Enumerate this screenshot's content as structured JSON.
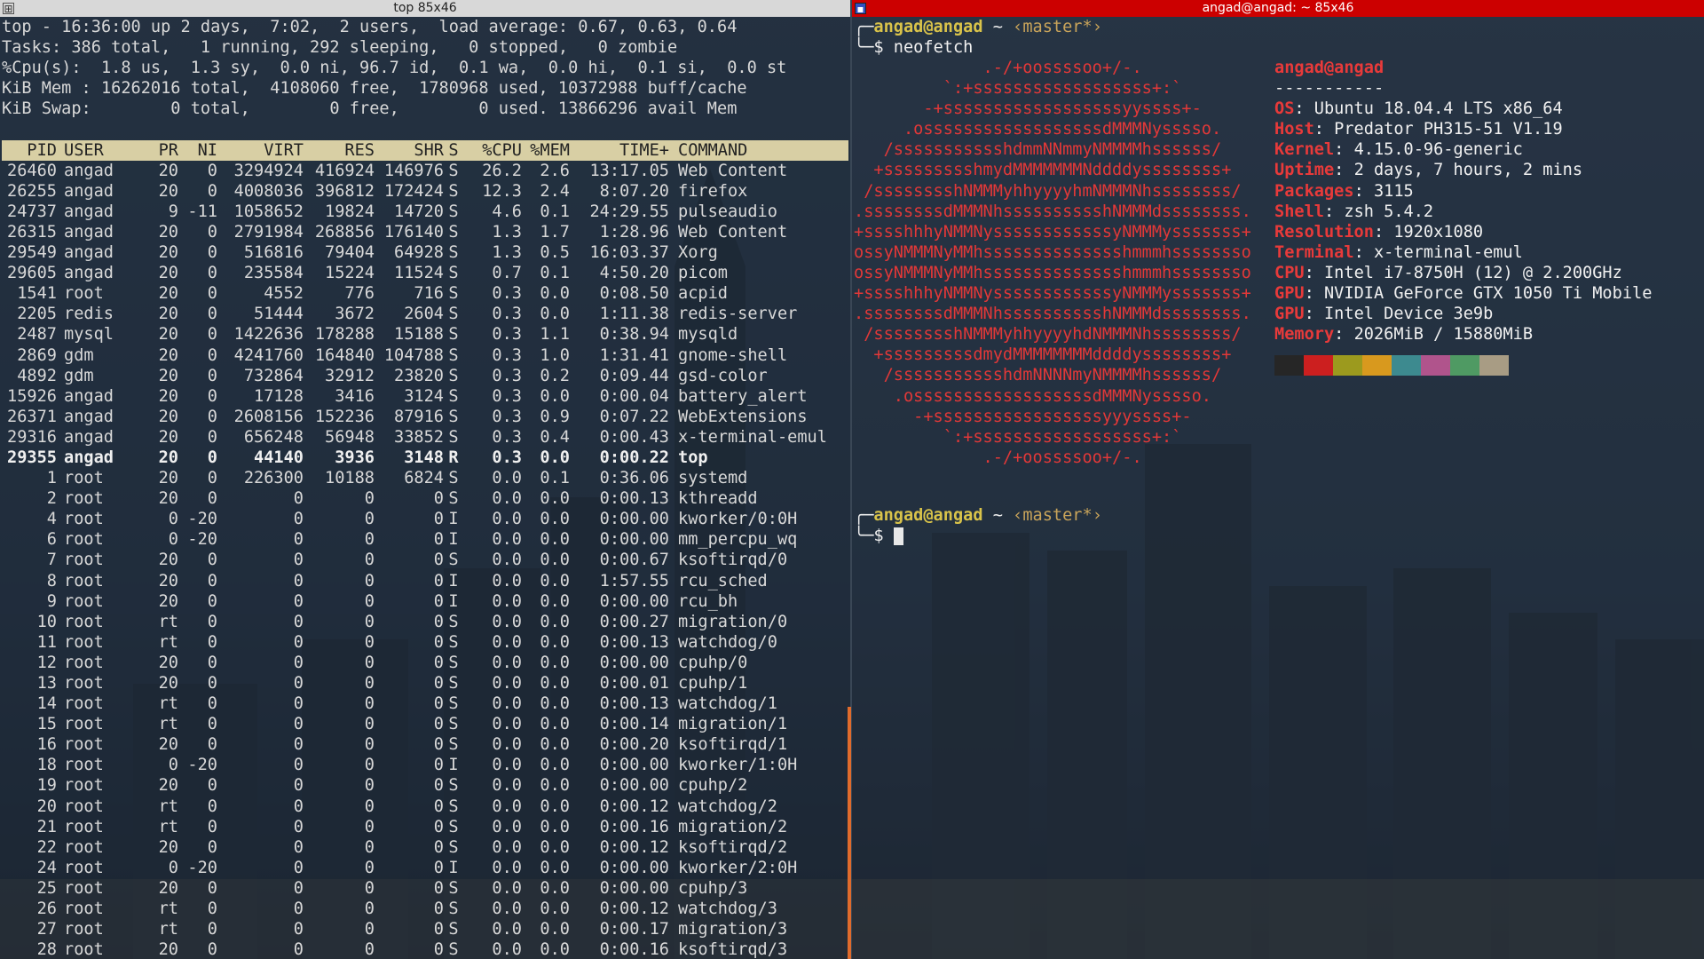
{
  "left_window": {
    "title": "top 85x46",
    "summary": [
      "top - 16:36:00 up 2 days,  7:02,  2 users,  load average: 0.67, 0.63, 0.64",
      "Tasks: 386 total,   1 running, 292 sleeping,   0 stopped,   0 zombie",
      "%Cpu(s):  1.8 us,  1.3 sy,  0.0 ni, 96.7 id,  0.1 wa,  0.0 hi,  0.1 si,  0.0 st",
      "KiB Mem : 16262016 total,  4108060 free,  1780968 used, 10372988 buff/cache",
      "KiB Swap:        0 total,        0 free,        0 used. 13866296 avail Mem"
    ],
    "columns": [
      "PID",
      "USER",
      "PR",
      "NI",
      "VIRT",
      "RES",
      "SHR",
      "S",
      "%CPU",
      "%MEM",
      "TIME+",
      "COMMAND"
    ],
    "processes": [
      [
        "26460",
        "angad",
        "20",
        "0",
        "3294924",
        "416924",
        "146976",
        "S",
        "26.2",
        "2.6",
        "13:17.05",
        "Web Content"
      ],
      [
        "26255",
        "angad",
        "20",
        "0",
        "4008036",
        "396812",
        "172424",
        "S",
        "12.3",
        "2.4",
        "8:07.20",
        "firefox"
      ],
      [
        "24737",
        "angad",
        "9",
        "-11",
        "1058652",
        "19824",
        "14720",
        "S",
        "4.6",
        "0.1",
        "24:29.55",
        "pulseaudio"
      ],
      [
        "26315",
        "angad",
        "20",
        "0",
        "2791984",
        "268856",
        "176140",
        "S",
        "1.3",
        "1.7",
        "1:28.96",
        "Web Content"
      ],
      [
        "29549",
        "angad",
        "20",
        "0",
        "516816",
        "79404",
        "64928",
        "S",
        "1.3",
        "0.5",
        "16:03.37",
        "Xorg"
      ],
      [
        "29605",
        "angad",
        "20",
        "0",
        "235584",
        "15224",
        "11524",
        "S",
        "0.7",
        "0.1",
        "4:50.20",
        "picom"
      ],
      [
        "1541",
        "root",
        "20",
        "0",
        "4552",
        "776",
        "716",
        "S",
        "0.3",
        "0.0",
        "0:08.50",
        "acpid"
      ],
      [
        "2205",
        "redis",
        "20",
        "0",
        "51444",
        "3672",
        "2604",
        "S",
        "0.3",
        "0.0",
        "1:11.38",
        "redis-server"
      ],
      [
        "2487",
        "mysql",
        "20",
        "0",
        "1422636",
        "178288",
        "15188",
        "S",
        "0.3",
        "1.1",
        "0:38.94",
        "mysqld"
      ],
      [
        "2869",
        "gdm",
        "20",
        "0",
        "4241760",
        "164840",
        "104788",
        "S",
        "0.3",
        "1.0",
        "1:31.41",
        "gnome-shell"
      ],
      [
        "4892",
        "gdm",
        "20",
        "0",
        "732864",
        "32912",
        "23820",
        "S",
        "0.3",
        "0.2",
        "0:09.44",
        "gsd-color"
      ],
      [
        "15926",
        "angad",
        "20",
        "0",
        "17128",
        "3416",
        "3124",
        "S",
        "0.3",
        "0.0",
        "0:00.04",
        "battery_alert"
      ],
      [
        "26371",
        "angad",
        "20",
        "0",
        "2608156",
        "152236",
        "87916",
        "S",
        "0.3",
        "0.9",
        "0:07.22",
        "WebExtensions"
      ],
      [
        "29316",
        "angad",
        "20",
        "0",
        "656248",
        "56948",
        "33852",
        "S",
        "0.3",
        "0.4",
        "0:00.43",
        "x-terminal-emul"
      ],
      [
        "29355",
        "angad",
        "20",
        "0",
        "44140",
        "3936",
        "3148",
        "R",
        "0.3",
        "0.0",
        "0:00.22",
        "top"
      ],
      [
        "1",
        "root",
        "20",
        "0",
        "226300",
        "10188",
        "6824",
        "S",
        "0.0",
        "0.1",
        "0:36.06",
        "systemd"
      ],
      [
        "2",
        "root",
        "20",
        "0",
        "0",
        "0",
        "0",
        "S",
        "0.0",
        "0.0",
        "0:00.13",
        "kthreadd"
      ],
      [
        "4",
        "root",
        "0",
        "-20",
        "0",
        "0",
        "0",
        "I",
        "0.0",
        "0.0",
        "0:00.00",
        "kworker/0:0H"
      ],
      [
        "6",
        "root",
        "0",
        "-20",
        "0",
        "0",
        "0",
        "I",
        "0.0",
        "0.0",
        "0:00.00",
        "mm_percpu_wq"
      ],
      [
        "7",
        "root",
        "20",
        "0",
        "0",
        "0",
        "0",
        "S",
        "0.0",
        "0.0",
        "0:00.67",
        "ksoftirqd/0"
      ],
      [
        "8",
        "root",
        "20",
        "0",
        "0",
        "0",
        "0",
        "I",
        "0.0",
        "0.0",
        "1:57.55",
        "rcu_sched"
      ],
      [
        "9",
        "root",
        "20",
        "0",
        "0",
        "0",
        "0",
        "I",
        "0.0",
        "0.0",
        "0:00.00",
        "rcu_bh"
      ],
      [
        "10",
        "root",
        "rt",
        "0",
        "0",
        "0",
        "0",
        "S",
        "0.0",
        "0.0",
        "0:00.27",
        "migration/0"
      ],
      [
        "11",
        "root",
        "rt",
        "0",
        "0",
        "0",
        "0",
        "S",
        "0.0",
        "0.0",
        "0:00.13",
        "watchdog/0"
      ],
      [
        "12",
        "root",
        "20",
        "0",
        "0",
        "0",
        "0",
        "S",
        "0.0",
        "0.0",
        "0:00.00",
        "cpuhp/0"
      ],
      [
        "13",
        "root",
        "20",
        "0",
        "0",
        "0",
        "0",
        "S",
        "0.0",
        "0.0",
        "0:00.01",
        "cpuhp/1"
      ],
      [
        "14",
        "root",
        "rt",
        "0",
        "0",
        "0",
        "0",
        "S",
        "0.0",
        "0.0",
        "0:00.13",
        "watchdog/1"
      ],
      [
        "15",
        "root",
        "rt",
        "0",
        "0",
        "0",
        "0",
        "S",
        "0.0",
        "0.0",
        "0:00.14",
        "migration/1"
      ],
      [
        "16",
        "root",
        "20",
        "0",
        "0",
        "0",
        "0",
        "S",
        "0.0",
        "0.0",
        "0:00.20",
        "ksoftirqd/1"
      ],
      [
        "18",
        "root",
        "0",
        "-20",
        "0",
        "0",
        "0",
        "I",
        "0.0",
        "0.0",
        "0:00.00",
        "kworker/1:0H"
      ],
      [
        "19",
        "root",
        "20",
        "0",
        "0",
        "0",
        "0",
        "S",
        "0.0",
        "0.0",
        "0:00.00",
        "cpuhp/2"
      ],
      [
        "20",
        "root",
        "rt",
        "0",
        "0",
        "0",
        "0",
        "S",
        "0.0",
        "0.0",
        "0:00.12",
        "watchdog/2"
      ],
      [
        "21",
        "root",
        "rt",
        "0",
        "0",
        "0",
        "0",
        "S",
        "0.0",
        "0.0",
        "0:00.16",
        "migration/2"
      ],
      [
        "22",
        "root",
        "20",
        "0",
        "0",
        "0",
        "0",
        "S",
        "0.0",
        "0.0",
        "0:00.12",
        "ksoftirqd/2"
      ],
      [
        "24",
        "root",
        "0",
        "-20",
        "0",
        "0",
        "0",
        "I",
        "0.0",
        "0.0",
        "0:00.00",
        "kworker/2:0H"
      ],
      [
        "25",
        "root",
        "20",
        "0",
        "0",
        "0",
        "0",
        "S",
        "0.0",
        "0.0",
        "0:00.00",
        "cpuhp/3"
      ],
      [
        "26",
        "root",
        "rt",
        "0",
        "0",
        "0",
        "0",
        "S",
        "0.0",
        "0.0",
        "0:00.12",
        "watchdog/3"
      ],
      [
        "27",
        "root",
        "rt",
        "0",
        "0",
        "0",
        "0",
        "S",
        "0.0",
        "0.0",
        "0:00.17",
        "migration/3"
      ],
      [
        "28",
        "root",
        "20",
        "0",
        "0",
        "0",
        "0",
        "S",
        "0.0",
        "0.0",
        "0:00.16",
        "ksoftirqd/3"
      ]
    ],
    "bold_pid": "29355"
  },
  "right_window": {
    "title": "angad@angad: ~ 85x46",
    "prompt": {
      "user": "angad@angad",
      "tilde": "~",
      "branch": "‹master*›",
      "symbol": "$",
      "command": "neofetch"
    },
    "ascii_art": [
      "             .-/+oossssoo+/-.",
      "         `:+ssssssssssssssssss+:`",
      "       -+ssssssssssssssssssyyssss+-",
      "     .ossssssssssssssssssdMMMNysssso.",
      "   /ssssssssssshdmmNNmmyNMMMMhssssss/",
      "  +ssssssssshmydMMMMMMMNddddyssssssss+",
      " /sssssssshNMMMyhhyyyyhmNMMMNhssssssss/",
      ".ssssssssdMMMNhsssssssssshNMMMdssssssss.",
      "+sssshhhyNMMNyssssssssssssyNMMMysssssss+",
      "ossyNMMMNyMMhsssssssssssssshmmmhssssssso",
      "ossyNMMMNyMMhsssssssssssssshmmmhssssssso",
      "+sssshhhyNMMNyssssssssssssyNMMMysssssss+",
      ".ssssssssdMMMNhsssssssssshNMMMdssssssss.",
      " /sssssssshNMMMyhhyyyyhdNMMMNhssssssss/",
      "  +sssssssssdmydMMMMMMMMddddyssssssss+",
      "   /ssssssssssshdmNNNNmyNMMMMhssssss/",
      "    .ossssssssssssssssssdMMMNysssso.",
      "      -+sssssssssssssssssyyyssss+-",
      "         `:+ssssssssssssssssss+:`",
      "             .-/+oossssoo+/-."
    ],
    "info": {
      "user_host": "angad@angad",
      "separator": "-----------",
      "fields": [
        {
          "key": "OS",
          "value": "Ubuntu 18.04.4 LTS x86_64"
        },
        {
          "key": "Host",
          "value": "Predator PH315-51 V1.19"
        },
        {
          "key": "Kernel",
          "value": "4.15.0-96-generic"
        },
        {
          "key": "Uptime",
          "value": "2 days, 7 hours, 2 mins"
        },
        {
          "key": "Packages",
          "value": "3115"
        },
        {
          "key": "Shell",
          "value": "zsh 5.4.2"
        },
        {
          "key": "Resolution",
          "value": "1920x1080"
        },
        {
          "key": "Terminal",
          "value": "x-terminal-emul"
        },
        {
          "key": "CPU",
          "value": "Intel i7-8750H (12) @ 2.200GHz"
        },
        {
          "key": "GPU",
          "value": "NVIDIA GeForce GTX 1050 Ti Mobile"
        },
        {
          "key": "GPU",
          "value": "Intel Device 3e9b"
        },
        {
          "key": "Memory",
          "value": "2026MiB / 15880MiB"
        }
      ],
      "palette": [
        "#262626",
        "#cc1f1f",
        "#9c9a1e",
        "#d8991e",
        "#3d8a8f",
        "#b0548c",
        "#4f9a63",
        "#a89c84"
      ]
    },
    "prompt2": {
      "user": "angad@angad",
      "tilde": "~",
      "branch": "‹master*›",
      "symbol": "$"
    }
  }
}
